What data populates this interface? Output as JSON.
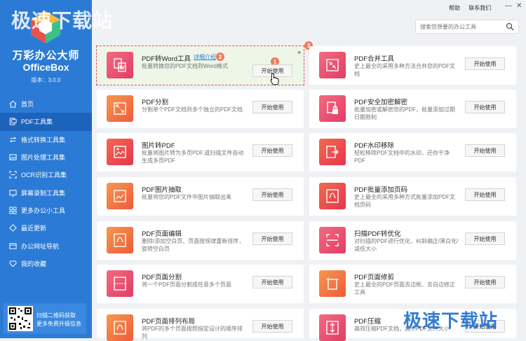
{
  "window": {
    "help": "帮助",
    "contact": "联系我们",
    "minimize": "—",
    "close": "✕"
  },
  "watermark": {
    "top": "极速下载站",
    "bottom": "极速下载站"
  },
  "sidebar": {
    "title": "万彩办公大师",
    "subtitle": "OfficeBox",
    "version": "版本：3.0.0",
    "items": [
      {
        "label": "首页",
        "icon": "home-icon"
      },
      {
        "label": "PDF工具集",
        "icon": "pdf-icon",
        "active": true
      },
      {
        "label": "格式转换工具集",
        "icon": "convert-icon"
      },
      {
        "label": "图片处理工具集",
        "icon": "image-icon"
      },
      {
        "label": "OCR识别工具集",
        "icon": "ocr-icon"
      },
      {
        "label": "屏幕录制工具集",
        "icon": "record-icon"
      },
      {
        "label": "更多办公小工具",
        "icon": "grid-icon"
      },
      {
        "label": "最近更新",
        "icon": "update-icon"
      },
      {
        "label": "办公网址导航",
        "icon": "nav-icon"
      },
      {
        "label": "我的收藏",
        "icon": "heart-icon"
      }
    ],
    "qr_line1": "扫描二维码获取",
    "qr_line2": "更多免费升级信息"
  },
  "search": {
    "placeholder": "搜索您想要的办公工具"
  },
  "cards": [
    {
      "name": "PDF转Word工具",
      "desc": "批量转换您的PDF文档到Word格式",
      "button": "开始使用",
      "detail": "详细介绍"
    },
    {
      "name": "PDF合并工具",
      "desc": "史上最全的采用多种方法合并您的PDF文档",
      "button": "开始使用"
    },
    {
      "name": "PDF分割",
      "desc": "分割单个PDF文档到多个独立的PDF文档",
      "button": "开始使用"
    },
    {
      "name": "PDF安全加密解密",
      "desc": "批量加密或解密您的PDF，批量添加过期日期限制",
      "button": "开始使用"
    },
    {
      "name": "图片转PDF",
      "desc": "批量将图片转为多页PDF,或扫描文件自动生成多页PDF",
      "button": "开始使用"
    },
    {
      "name": "PDF水印移除",
      "desc": "轻松移除PDF文档中的水印，还你干净PDF",
      "button": "开始使用"
    },
    {
      "name": "PDF图片抽取",
      "desc": "批量将您的PDF文件中图片抽取出来",
      "button": "开始使用"
    },
    {
      "name": "PDF批量添加页码",
      "desc": "史上最全的采用多种方式批量添加PDF文档页码",
      "button": "开始使用"
    },
    {
      "name": "PDF页面编辑",
      "desc": "删除/添加空白页、页面按规律重新排序，旋转空白页",
      "button": "开始使用"
    },
    {
      "name": "扫描PDF转优化",
      "desc": "对扫描的PDF进行优化，纠斜偏正/黑白化/减低大小",
      "button": "开始使用"
    },
    {
      "name": "PDF页面分割",
      "desc": "将一个PDF页面分割成任意多个页面",
      "button": "开始使用"
    },
    {
      "name": "PDF页面修剪",
      "desc": "史上最全的PDF页面去边框、去白边修正工具",
      "button": "开始使用"
    },
    {
      "name": "PDF页面排列布局",
      "desc": "将PDF的多个页面按照指定设计的顺序排列",
      "button": "开始使用"
    },
    {
      "name": "PDF压缩",
      "desc": "高效压缩PDF文档，减小PDF文件大小",
      "button": "开始使用"
    }
  ],
  "annotations": {
    "one": "1",
    "two": "2",
    "three": "3"
  },
  "colors": {
    "sidebar": "#2b7bd6",
    "active": "#1c63bb",
    "accent": "#e8344e"
  }
}
